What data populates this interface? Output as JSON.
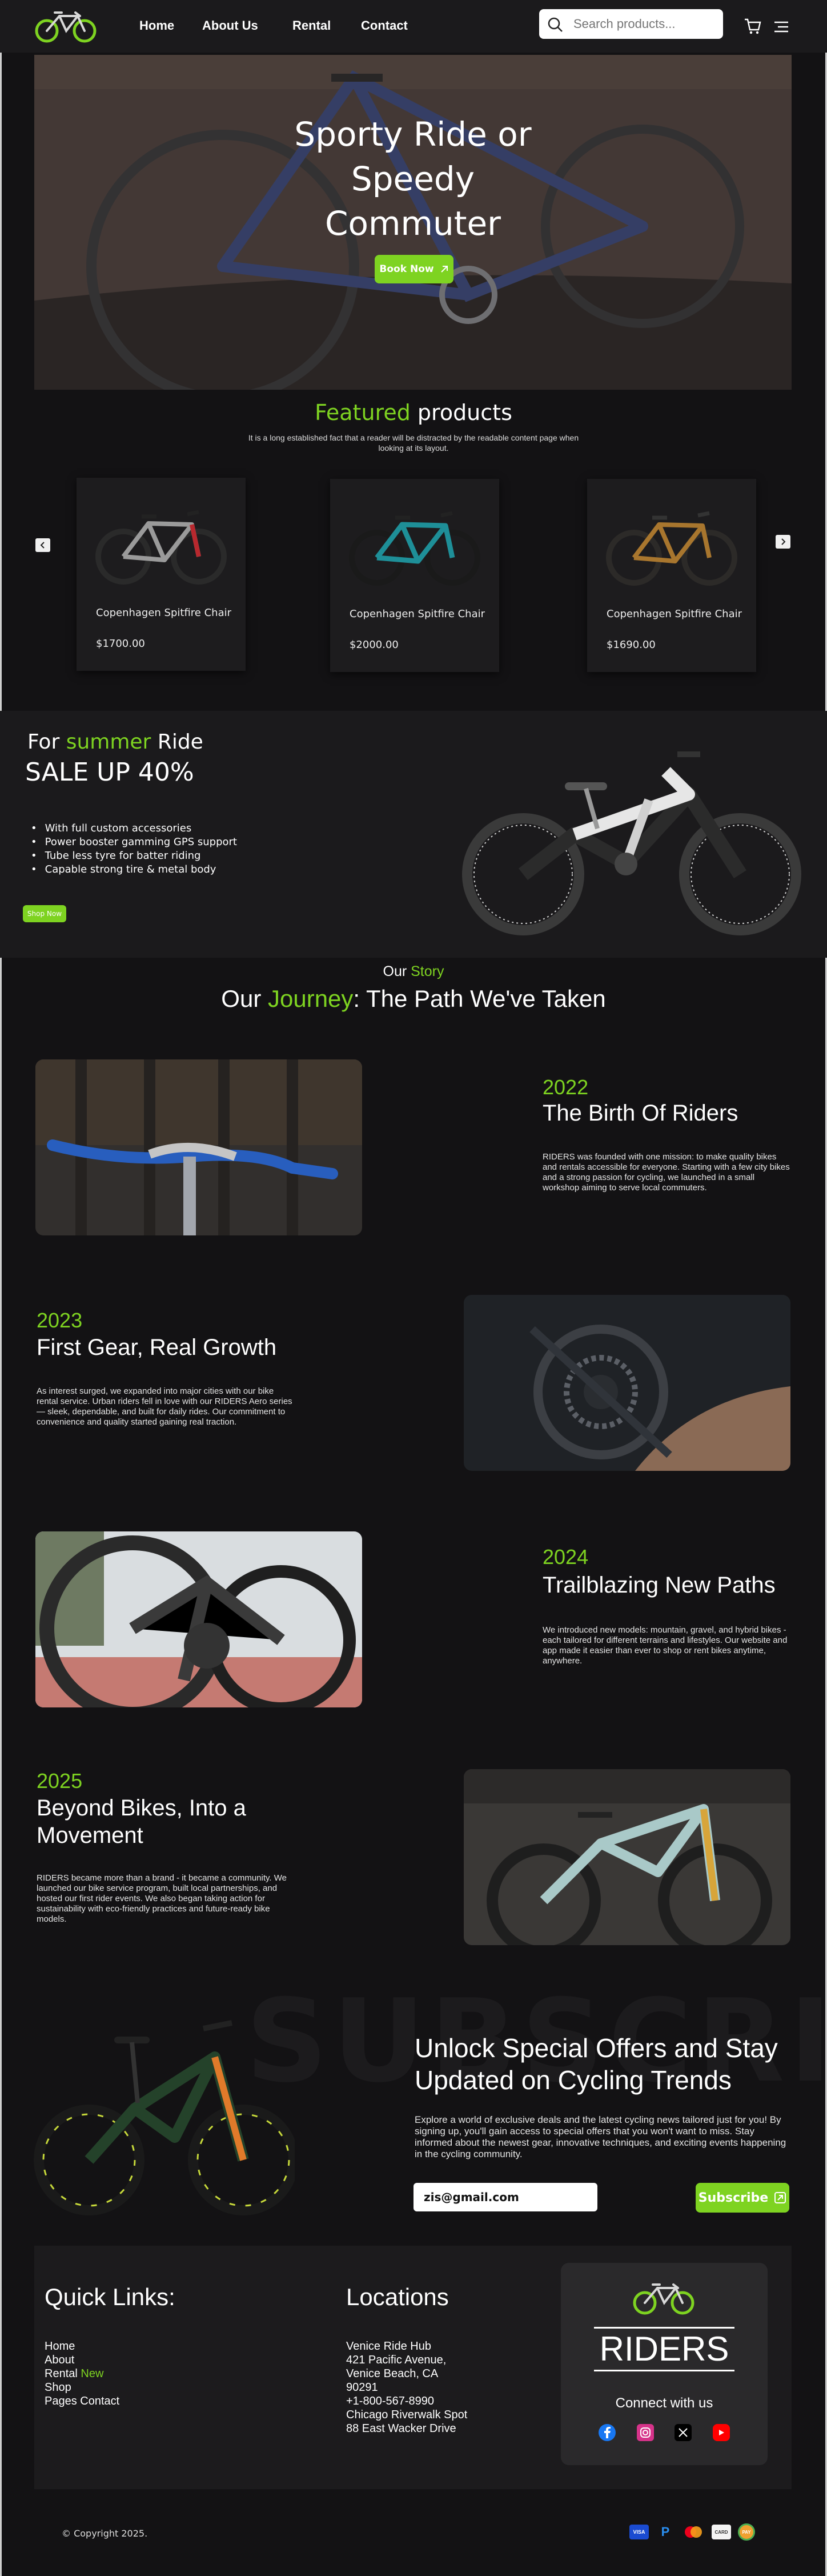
{
  "header": {
    "nav": [
      "Home",
      "About Us",
      "Rental",
      "Contact"
    ],
    "search_placeholder": "Search products..."
  },
  "hero": {
    "title": "Sporty Ride or Speedy Commuter",
    "cta": "Book Now"
  },
  "featured": {
    "title_highlight": "Featured",
    "title_rest": " products",
    "subtitle": "It is a long established fact that a reader will be distracted by the readable content page when looking at its layout.",
    "products": [
      {
        "name": "Copenhagen Spitfire Chair",
        "price": "$1700.00",
        "color": "#b8282e"
      },
      {
        "name": "Copenhagen Spitfire Chair",
        "price": "$2000.00",
        "color": "#1e8f98"
      },
      {
        "name": "Copenhagen Spitfire Chair",
        "price": "$1690.00",
        "color": "#a8762e"
      }
    ]
  },
  "promo": {
    "title_pre": "For ",
    "title_highlight": "summer",
    "title_post": " Ride",
    "sale": "SALE UP 40%",
    "features": [
      "With full custom accessories",
      "Power booster gamming GPS support",
      "Tube less tyre for batter riding",
      "Capable strong tire & metal body"
    ],
    "cta": "Shop Now"
  },
  "story": {
    "small_pre": "Our ",
    "small_highlight": "Story",
    "title_pre": "Our ",
    "title_highlight": "Journey",
    "title_post": ": The Path We've Taken",
    "milestones": [
      {
        "year": "2022",
        "heading": "The Birth Of Riders",
        "text": "RIDERS was founded with one mission: to make quality bikes and rentals accessible for everyone. Starting with a few city bikes and a strong passion for cycling, we launched in a small workshop aiming to serve local commuters."
      },
      {
        "year": "2023",
        "heading": "First Gear, Real Growth",
        "text": " As interest surged, we expanded into major cities with our bike rental service. Urban riders fell in love with our RIDERS Aero series — sleek, dependable, and built for daily rides. Our commitment to convenience and quality started gaining real traction."
      },
      {
        "year": "2024",
        "heading": "Trailblazing New Paths",
        "text": "We introduced new models: mountain, gravel, and hybrid bikes - each tailored for different terrains and lifestyles. Our website and app made it easier than ever to shop or rent bikes anytime, anywhere."
      },
      {
        "year": "2025",
        "heading": "Beyond Bikes, Into a Movement",
        "text": "RIDERS became more than a brand - it became a community. We launched our bike service program, built local partnerships, and hosted our first rider events. We also began taking action for sustainability with eco-friendly practices and future-ready bike models."
      }
    ]
  },
  "subscribe": {
    "bg_word": "SUBSCRIBE",
    "title": "Unlock Special Offers and Stay Updated on Cycling Trends",
    "text": "Explore a world of exclusive deals and the latest cycling news tailored just for you! By signing up, you'll gain access to special offers that you won't want to miss. Stay informed about the newest gear, innovative techniques, and exciting events happening in the cycling community.",
    "email_value": "zis@gmail.com",
    "cta": "Subscribe"
  },
  "footer": {
    "quick_title": "Quick Links:",
    "links": [
      {
        "label": "Home",
        "badge": ""
      },
      {
        "label": "About",
        "badge": ""
      },
      {
        "label": "Rental",
        "badge": "New"
      },
      {
        "label": "Shop",
        "badge": ""
      },
      {
        "label": "Pages Contact",
        "badge": ""
      }
    ],
    "loc_title": "Locations",
    "locations": [
      "Venice Ride Hub",
      "421 Pacific Avenue,",
      "Venice Beach, CA",
      "90291",
      "+1-800-567-8990",
      "Chicago Riverwalk Spot",
      "88 East Wacker Drive"
    ],
    "brand": "RIDERS",
    "connect": "Connect with us",
    "copyright": "© Copyright 2025.",
    "payments": [
      "VISA",
      "P",
      "MC",
      "CARD",
      "PAY"
    ]
  },
  "colors": {
    "accent": "#7ed321",
    "bg": "#131214"
  }
}
